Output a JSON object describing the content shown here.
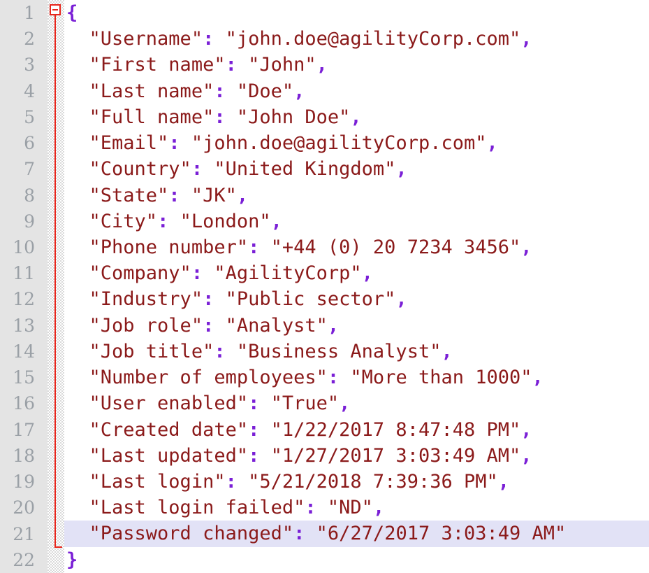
{
  "editor": {
    "language": "json",
    "total_lines": 22,
    "highlighted_line": 21,
    "fold_icon": "fold-collapse-icon",
    "colors": {
      "gutter_background": "#e4e4e4",
      "line_number": "#9aa0a6",
      "string": "#8b1a1a",
      "punctuation": "#7a1fd6",
      "fold_marker": "#e8261c",
      "highlight_row": "#e2e2f6",
      "background": "#ffffff"
    }
  },
  "line_numbers": [
    "1",
    "2",
    "3",
    "4",
    "5",
    "6",
    "7",
    "8",
    "9",
    "10",
    "11",
    "12",
    "13",
    "14",
    "15",
    "16",
    "17",
    "18",
    "19",
    "20",
    "21",
    "22"
  ],
  "lines": [
    {
      "n": "1",
      "indent": 0,
      "open_brace": "{",
      "key": "",
      "value": "",
      "comma": "",
      "close_brace": ""
    },
    {
      "n": "2",
      "indent": 2,
      "key": "Username",
      "value": "john.doe@agilityCorp.com",
      "comma": ","
    },
    {
      "n": "3",
      "indent": 2,
      "key": "First name",
      "value": "John",
      "comma": ","
    },
    {
      "n": "4",
      "indent": 2,
      "key": "Last name",
      "value": "Doe",
      "comma": ","
    },
    {
      "n": "5",
      "indent": 2,
      "key": "Full name",
      "value": "John Doe",
      "comma": ","
    },
    {
      "n": "6",
      "indent": 2,
      "key": "Email",
      "value": "john.doe@agilityCorp.com",
      "comma": ","
    },
    {
      "n": "7",
      "indent": 2,
      "key": "Country",
      "value": "United Kingdom",
      "comma": ","
    },
    {
      "n": "8",
      "indent": 2,
      "key": "State",
      "value": "JK",
      "comma": ","
    },
    {
      "n": "9",
      "indent": 2,
      "key": "City",
      "value": "London",
      "comma": ","
    },
    {
      "n": "10",
      "indent": 2,
      "key": "Phone number",
      "value": "+44 (0) 20 7234 3456",
      "comma": ","
    },
    {
      "n": "11",
      "indent": 2,
      "key": "Company",
      "value": "AgilityCorp",
      "comma": ","
    },
    {
      "n": "12",
      "indent": 2,
      "key": "Industry",
      "value": "Public sector",
      "comma": ","
    },
    {
      "n": "13",
      "indent": 2,
      "key": "Job role",
      "value": "Analyst",
      "comma": ","
    },
    {
      "n": "14",
      "indent": 2,
      "key": "Job title",
      "value": "Business Analyst",
      "comma": ","
    },
    {
      "n": "15",
      "indent": 2,
      "key": "Number of employees",
      "value": "More than 1000",
      "comma": ","
    },
    {
      "n": "16",
      "indent": 2,
      "key": "User enabled",
      "value": "True",
      "comma": ","
    },
    {
      "n": "17",
      "indent": 2,
      "key": "Created date",
      "value": "1/22/2017 8:47:48 PM",
      "comma": ","
    },
    {
      "n": "18",
      "indent": 2,
      "key": "Last updated",
      "value": "1/27/2017 3:03:49 AM",
      "comma": ","
    },
    {
      "n": "19",
      "indent": 2,
      "key": "Last login",
      "value": "5/21/2018 7:39:36 PM",
      "comma": ","
    },
    {
      "n": "20",
      "indent": 2,
      "key": "Last login failed",
      "value": "ND",
      "comma": ","
    },
    {
      "n": "21",
      "indent": 2,
      "key": "Password changed",
      "value": "6/27/2017 3:03:49 AM",
      "comma": ""
    },
    {
      "n": "22",
      "indent": 0,
      "open_brace": "",
      "key": "",
      "value": "",
      "comma": "",
      "close_brace": "}"
    }
  ],
  "document": {
    "Username": "john.doe@agilityCorp.com",
    "First name": "John",
    "Last name": "Doe",
    "Full name": "John Doe",
    "Email": "john.doe@agilityCorp.com",
    "Country": "United Kingdom",
    "State": "JK",
    "City": "London",
    "Phone number": "+44 (0) 20 7234 3456",
    "Company": "AgilityCorp",
    "Industry": "Public sector",
    "Job role": "Analyst",
    "Job title": "Business Analyst",
    "Number of employees": "More than 1000",
    "User enabled": "True",
    "Created date": "1/22/2017 8:47:48 PM",
    "Last updated": "1/27/2017 3:03:49 AM",
    "Last login": "5/21/2018 7:39:36 PM",
    "Last login failed": "ND",
    "Password changed": "6/27/2017 3:03:49 AM"
  }
}
